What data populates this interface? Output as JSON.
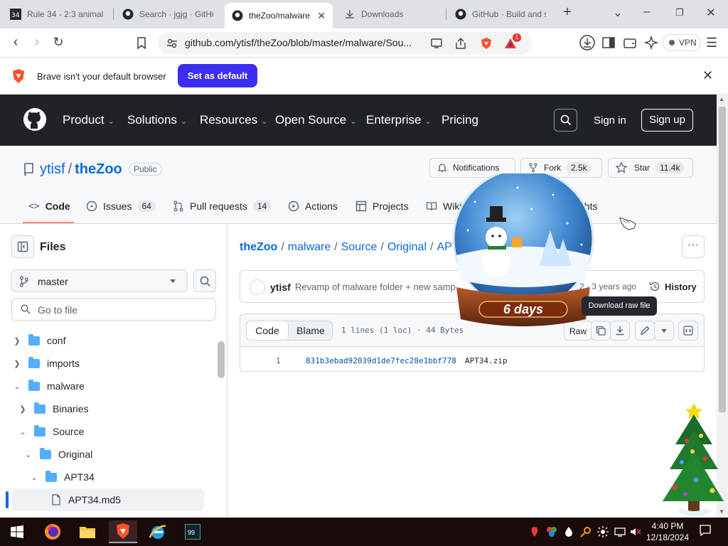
{
  "browser": {
    "tabs": [
      {
        "title": "Rule 34 - 2:3 animal",
        "active": false
      },
      {
        "title": "Search · jgjg · GitHub",
        "active": false
      },
      {
        "title": "theZoo/malware",
        "active": true
      },
      {
        "title": "Downloads",
        "active": false
      },
      {
        "title": "GitHub · Build and s",
        "active": false
      }
    ],
    "new_tab": "+",
    "url": "github.com/ytisf/theZoo/blob/master/malware/Sou...",
    "shield_badge": "1",
    "vpn_label": "VPN"
  },
  "infobar": {
    "message": "Brave isn't your default browser",
    "button": "Set as default"
  },
  "gh_header": {
    "nav": [
      "Product",
      "Solutions",
      "Resources",
      "Open Source",
      "Enterprise",
      "Pricing"
    ],
    "sign_in": "Sign in",
    "sign_up": "Sign up"
  },
  "repo": {
    "owner": "ytisf",
    "name": "theZoo",
    "visibility": "Public",
    "notifications": "Notifications",
    "fork_label": "Fork",
    "fork_count": "2.5k",
    "star_label": "Star",
    "star_count": "11.4k",
    "tabs": [
      {
        "label": "Code",
        "count": ""
      },
      {
        "label": "Issues",
        "count": "64"
      },
      {
        "label": "Pull requests",
        "count": "14"
      },
      {
        "label": "Actions",
        "count": ""
      },
      {
        "label": "Projects",
        "count": ""
      },
      {
        "label": "Wiki",
        "count": ""
      },
      {
        "label": "Insights",
        "visible_text": "ghts"
      }
    ]
  },
  "sidebar": {
    "title": "Files",
    "branch": "master",
    "goto_placeholder": "Go to file",
    "tree": [
      {
        "label": "conf",
        "expanded": false,
        "depth": 0
      },
      {
        "label": "imports",
        "expanded": false,
        "depth": 0
      },
      {
        "label": "malware",
        "expanded": true,
        "depth": 0
      },
      {
        "label": "Binaries",
        "expanded": false,
        "depth": 1
      },
      {
        "label": "Source",
        "expanded": true,
        "depth": 1
      },
      {
        "label": "Original",
        "expanded": true,
        "depth": 2
      },
      {
        "label": "APT34",
        "expanded": true,
        "depth": 3
      },
      {
        "label": "APT34.md5",
        "type": "file",
        "selected": true,
        "depth": 4
      }
    ]
  },
  "file_view": {
    "breadcrumbs": [
      "theZoo",
      "malware",
      "Source",
      "Original",
      "APT"
    ],
    "commit": {
      "author": "ytisf",
      "message": "Revamp of malware folder + new samp",
      "time": "2 · 3 years ago",
      "history": "History"
    },
    "toolbar": {
      "code": "Code",
      "blame": "Blame",
      "info": "1 lines (1 loc) · 44 Bytes",
      "raw": "Raw",
      "tooltip": "Download raw file"
    },
    "lines": [
      {
        "number": "1",
        "hash": "831b3ebad92039d1de7fec28e1bbf778",
        "file": "APT34.zip"
      }
    ]
  },
  "overlay": {
    "countdown": "6 days"
  },
  "taskbar": {
    "time": "4:40 PM",
    "date": "12/18/2024",
    "app_badge": "99"
  }
}
